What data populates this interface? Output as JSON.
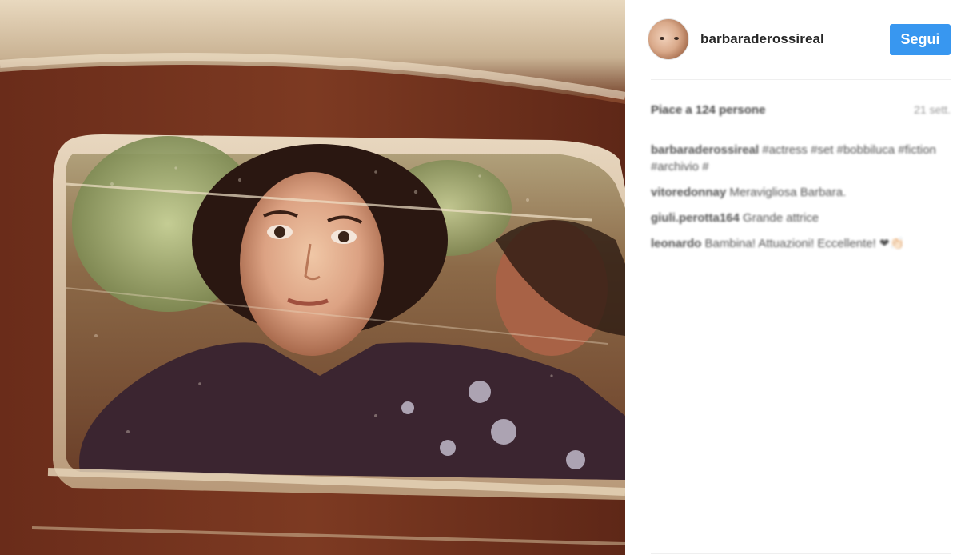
{
  "post": {
    "username": "barbaraderossireal",
    "follow_label": "Segui",
    "likes_text": "Piace a 124 persone",
    "time_text": "21 sett.",
    "comments": [
      {
        "author": "barbaraderossireal",
        "text": " #actress #set #bobbiluca #fiction #archivio #"
      },
      {
        "author": "vitoredonnay",
        "text": " Meravigliosa Barbara."
      },
      {
        "author": "giuli.perotta164",
        "text": " Grande attrice"
      },
      {
        "author": "leonardo",
        "text": " Bambina! Attuazioni! Eccellente! ❤👏🏻"
      }
    ]
  },
  "colors": {
    "follow_button": "#3897f0",
    "divider": "#efefef",
    "muted_text": "#999999"
  },
  "photo": {
    "description_icon": "photo-image"
  }
}
